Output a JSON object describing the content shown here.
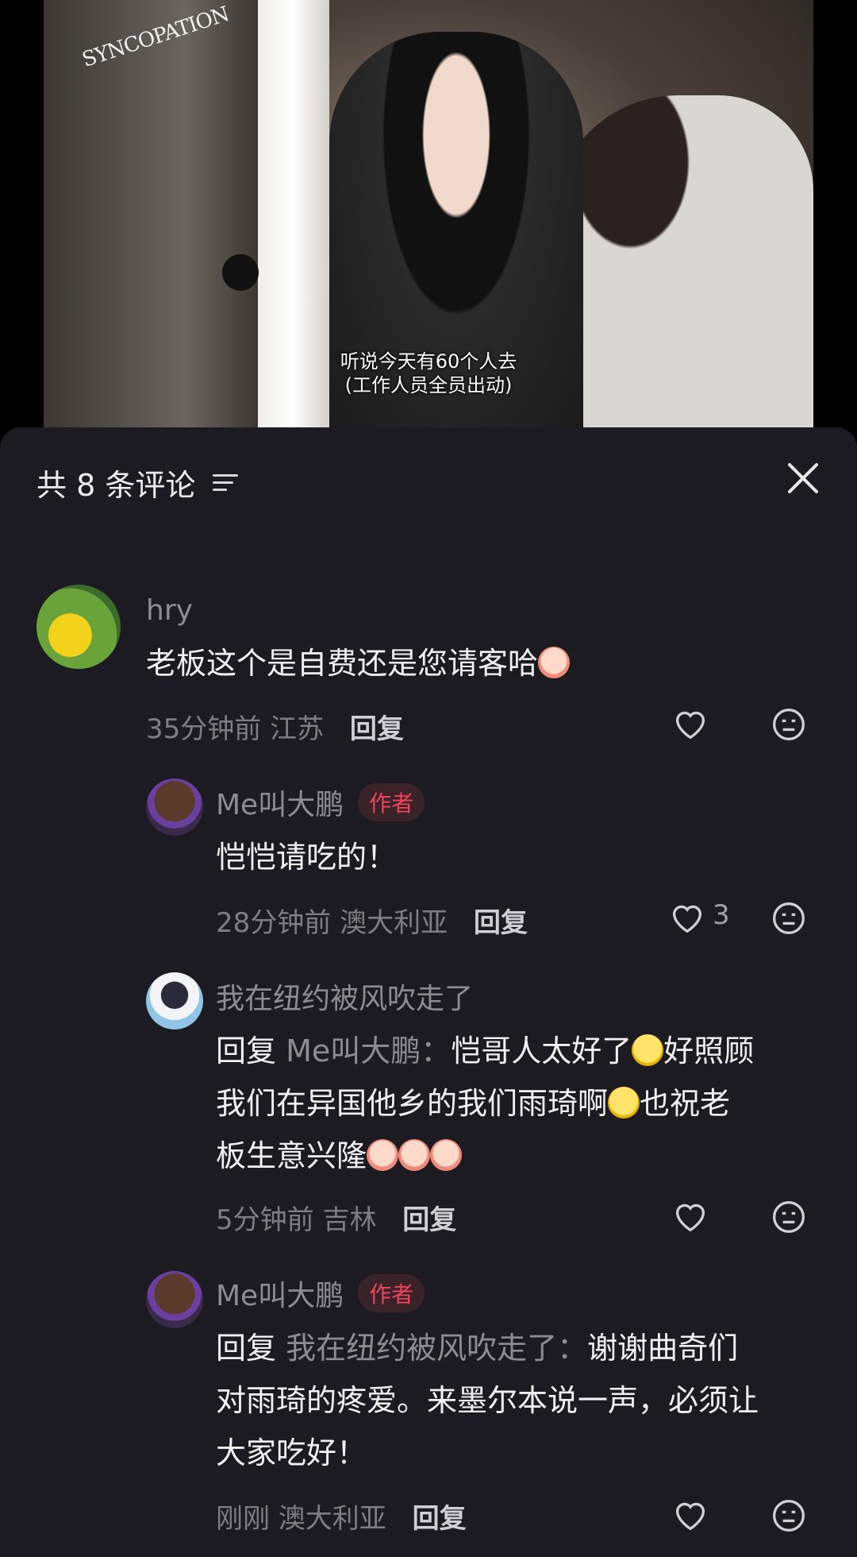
{
  "video": {
    "logo": "SYNCOPATION",
    "subtitle_line1": "听说今天有60个人去",
    "subtitle_line2": "(工作人员全员出动)"
  },
  "panel": {
    "title": "共 8 条评论",
    "filter_icon": "filter-icon",
    "close_icon": "close-icon"
  },
  "comments": [
    {
      "user": "hry",
      "text": "老板这个是自费还是您请客哈",
      "time": "35分钟前",
      "location": "江苏",
      "reply_label": "回复",
      "likes": ""
    },
    {
      "user": "Me叫大鹏",
      "badge": "作者",
      "text": "恺恺请吃的！",
      "time": "28分钟前",
      "location": "澳大利亚",
      "reply_label": "回复",
      "likes": "3"
    },
    {
      "user": "我在纽约被风吹走了",
      "reply_prefix": "回复",
      "reply_target": "Me叫大鹏：",
      "text_part1": "恺哥人太好了",
      "text_part2": "好照顾",
      "text_line2a": "我们在异国他乡的我们雨琦啊",
      "text_line2b": "也祝老",
      "text_line3": "板生意兴隆",
      "time": "5分钟前",
      "location": "吉林",
      "reply_label": "回复",
      "likes": ""
    },
    {
      "user": "Me叫大鹏",
      "badge": "作者",
      "reply_prefix": "回复",
      "reply_target": "我在纽约被风吹走了：",
      "text_line1": "谢谢曲奇们",
      "text_line2": "对雨琦的疼爱。来墨尔本说一声，必须让",
      "text_line3": "大家吃好！",
      "time": "刚刚",
      "location": "澳大利亚",
      "reply_label": "回复",
      "likes": ""
    }
  ],
  "colors": {
    "panel_bg": "#1c1b22",
    "muted_text": "#8c8c92",
    "author_badge": "#f0425b"
  }
}
